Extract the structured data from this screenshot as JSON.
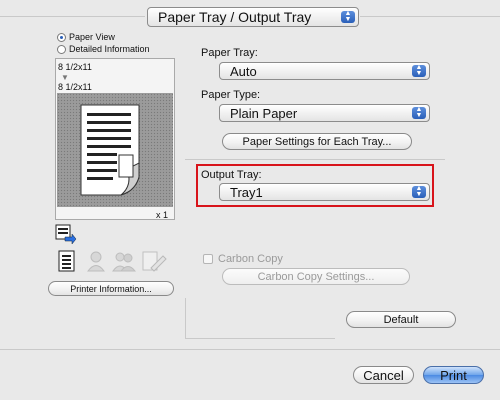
{
  "header": {
    "selected_panel": "Paper Tray / Output Tray"
  },
  "left_panel": {
    "view_options": [
      {
        "label": "Paper View",
        "selected": true
      },
      {
        "label": "Detailed Information",
        "selected": false
      }
    ],
    "paper_size_top": "8 1/2x11",
    "paper_size_bottom": "8 1/2x11",
    "copies_label": "x 1",
    "printer_info_button": "Printer Information..."
  },
  "right_panel": {
    "paper_tray": {
      "label": "Paper Tray:",
      "value": "Auto"
    },
    "paper_type": {
      "label": "Paper Type:",
      "value": "Plain Paper"
    },
    "paper_settings_button": "Paper Settings for Each Tray...",
    "output_tray": {
      "label": "Output Tray:",
      "value": "Tray1"
    },
    "carbon_copy": {
      "label": "Carbon Copy",
      "checked": false
    },
    "carbon_copy_settings_button": "Carbon Copy Settings...",
    "default_button": "Default"
  },
  "footer": {
    "cancel_button": "Cancel",
    "print_button": "Print"
  },
  "colors": {
    "highlight_border": "#d8141b",
    "accent_blue": "#2a5fb8",
    "background": "#e9e9e9"
  }
}
